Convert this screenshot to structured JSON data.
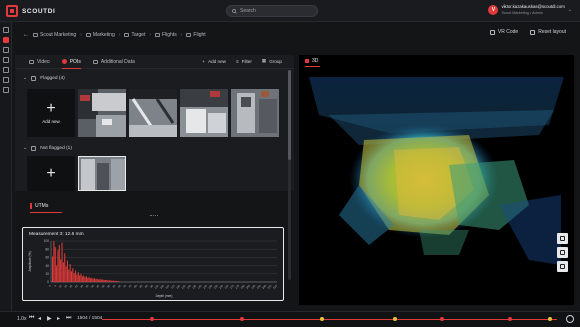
{
  "app": {
    "name": "SCOUTDI"
  },
  "search": {
    "placeholder": "Search"
  },
  "user": {
    "initial": "V",
    "email": "viktor.kazakauskas@scoutdi.com",
    "role": "Scout Marketing • Admin"
  },
  "breadcrumb": [
    "Scout Marketing",
    "Marketing",
    "Target",
    "Flights",
    "Flight"
  ],
  "header_actions": {
    "vr_code": "VR Code",
    "reset_layout": "Reset layout"
  },
  "tabs": [
    {
      "label": "Video",
      "active": false
    },
    {
      "label": "POIs",
      "active": true
    },
    {
      "label": "Additional Data",
      "active": false
    }
  ],
  "tab_actions": {
    "add_new": "Add new",
    "filter": "Filter",
    "group": "Group"
  },
  "groups": [
    {
      "label": "Flagged (4)",
      "add_label": "Add new",
      "thumbnail_count": 4
    },
    {
      "label": "Not flagged (1)",
      "add_label": "",
      "thumbnail_count": 1
    }
  ],
  "utm_panel": {
    "tab": "UTMs"
  },
  "chart_data": {
    "type": "bar",
    "title": "Measurement 3: 12.6 mm",
    "xlabel": "Depth (mm)",
    "ylabel": "Amplitude (%)",
    "ylim": [
      0,
      100
    ],
    "y_ticks": [
      "0",
      "20",
      "40",
      "60",
      "80",
      "100"
    ],
    "x_ticks": [
      "0",
      "5",
      "10",
      "15",
      "20",
      "25",
      "30",
      "35",
      "40",
      "45",
      "50",
      "55",
      "60",
      "65",
      "70",
      "75",
      "80",
      "85",
      "90",
      "95",
      "100",
      "105",
      "110",
      "115",
      "120",
      "125",
      "130",
      "135",
      "140",
      "145",
      "150",
      "155",
      "160",
      "165",
      "170",
      "175",
      "180",
      "185",
      "190",
      "195",
      "200",
      "205",
      "210"
    ],
    "x_range": [
      0,
      210
    ],
    "color": "#e03a3a",
    "grid": true,
    "values": [
      62,
      100,
      85,
      40,
      78,
      90,
      55,
      96,
      48,
      70,
      38,
      52,
      30,
      44,
      26,
      34,
      22,
      28,
      18,
      24,
      16,
      20,
      14,
      16,
      12,
      14,
      10,
      12,
      9,
      10,
      8,
      9,
      7,
      8,
      6,
      7,
      6,
      6,
      5,
      5,
      5,
      4,
      4,
      4,
      3,
      3,
      3,
      3,
      2,
      2
    ]
  },
  "viewer": {
    "tab": "3D"
  },
  "playback": {
    "speed": "1.0x",
    "frame": "1504 / 1504"
  },
  "colors": {
    "accent": "#e03a3a",
    "background": "#141517",
    "panel": "#1b1c1f"
  }
}
